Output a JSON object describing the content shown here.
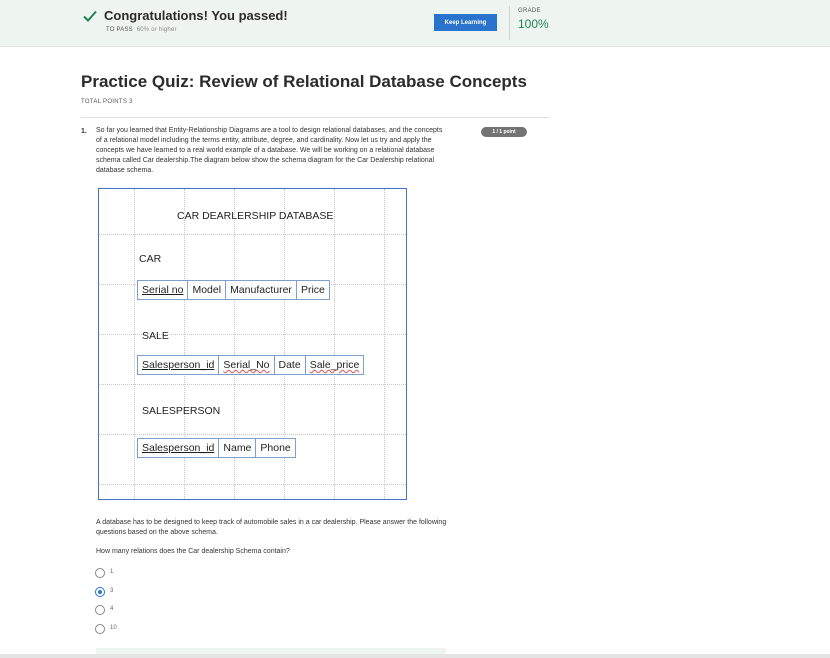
{
  "banner": {
    "title": "Congratulations! You passed!",
    "to_pass_label": "TO PASS",
    "to_pass_value": "60% or higher",
    "keep_learning_label": "Keep Learning",
    "grade_label": "GRADE",
    "grade_value": "100%",
    "check_icon": "check-icon",
    "accent_color": "#1f8354",
    "button_color": "#2a73cc"
  },
  "quiz": {
    "title": "Practice Quiz: Review of Relational Database Concepts",
    "total_points": "TOTAL POINTS 3"
  },
  "question1": {
    "number": "1.",
    "text": "So far you learned that Entity-Relationship Diagrams are a tool to design relational databases, and the concepts of a relational model including the terms entity, attribute, degree, and cardinality. Now let us try and apply the concepts we have learned to a real world example of a database. We will be working on a relational database schema called Car dealership.The diagram below show the schema diagram for the Car Dealership relational database schema.",
    "points_badge": "1 / 1 point",
    "diagram": {
      "title": "CAR DEARLERSHIP DATABASE",
      "car_label": "CAR",
      "car_cols": [
        "Serial no",
        "Model",
        "Manufacturer",
        "Price"
      ],
      "sale_label": "SALE",
      "sale_cols": [
        "Salesperson_id",
        "Serial_No",
        "Date",
        "Sale_price"
      ],
      "salesperson_label": "SALESPERSON",
      "salesperson_cols": [
        "Salesperson_id",
        "Name",
        "Phone"
      ]
    },
    "paragraph": "A database has to be designed to keep track of automobile sales in a car dealership. Please answer the following questions based on the above schema.",
    "prompt": "How many relations does the Car dealership Schema contain?",
    "options": [
      "1",
      "3",
      "4",
      "10"
    ],
    "selected": "3"
  }
}
